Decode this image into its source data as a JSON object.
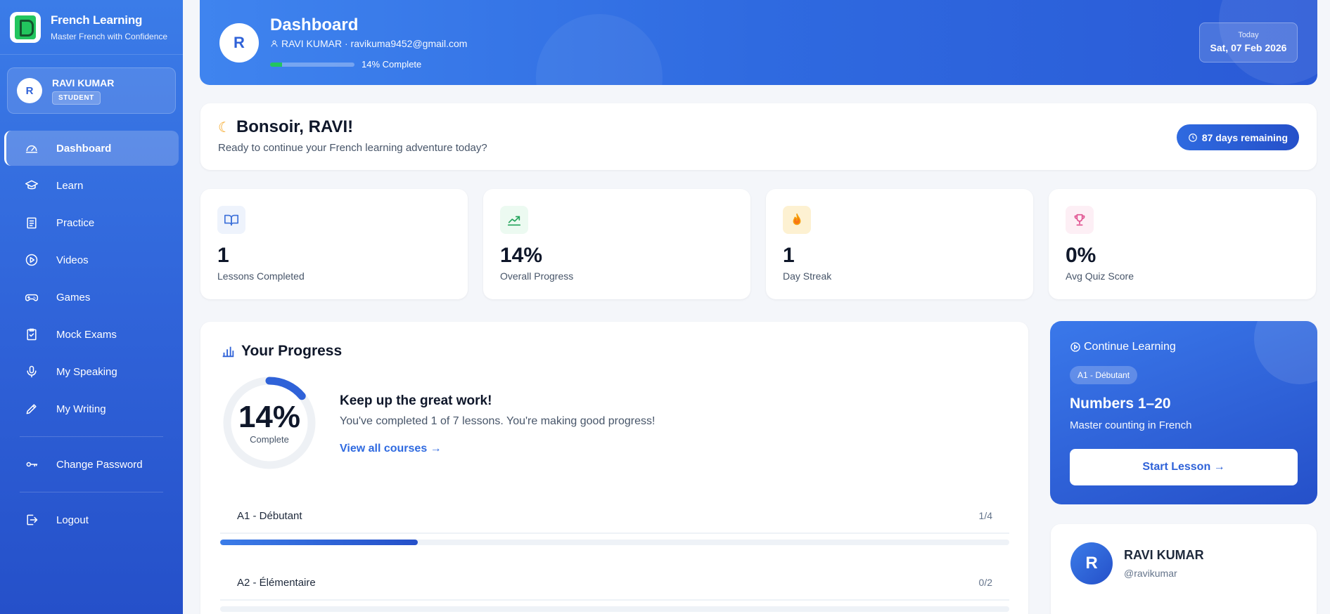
{
  "sidebar": {
    "brand_title": "French Learning",
    "brand_subtitle": "Master French with Confidence",
    "user": {
      "initial": "R",
      "name": "RAVI KUMAR",
      "role": "STUDENT"
    },
    "items": [
      {
        "label": "Dashboard",
        "icon": "dashboard-icon",
        "active": true
      },
      {
        "label": "Learn",
        "icon": "graduation-cap-icon"
      },
      {
        "label": "Practice",
        "icon": "clipboard-list-icon"
      },
      {
        "label": "Videos",
        "icon": "play-circle-icon"
      },
      {
        "label": "Games",
        "icon": "gamepad-icon"
      },
      {
        "label": "Mock Exams",
        "icon": "clipboard-check-icon"
      },
      {
        "label": "My Speaking",
        "icon": "microphone-icon"
      },
      {
        "label": "My Writing",
        "icon": "pen-icon"
      }
    ],
    "account": [
      {
        "label": "Change Password",
        "icon": "key-icon"
      },
      {
        "label": "Logout",
        "icon": "logout-icon"
      }
    ]
  },
  "header": {
    "initial": "R",
    "title": "Dashboard",
    "subtitle": "RAVI KUMAR · ravikuma9452@gmail.com",
    "progress_text": "14% Complete",
    "progress_value": 0.14,
    "date_label": "Today",
    "date_value": "Sat, 07 Feb 2026"
  },
  "greeting": {
    "title": "Bonsoir, RAVI!",
    "subtitle": "Ready to continue your French learning adventure today?",
    "days_remaining": "87 days remaining"
  },
  "stats": [
    {
      "value": "1",
      "label": "Lessons Completed",
      "icon": "book-open-icon",
      "color": "#3b6fd9",
      "bg": "#eef3fc"
    },
    {
      "value": "14%",
      "label": "Overall Progress",
      "icon": "trending-up-icon",
      "color": "#22a35a",
      "bg": "#ecfaf1"
    },
    {
      "value": "1",
      "label": "Day Streak",
      "icon": "flame-icon",
      "color": "#f59e0b",
      "bg": "#fdf1d2"
    },
    {
      "value": "0%",
      "label": "Avg Quiz Score",
      "icon": "trophy-icon",
      "color": "#e05290",
      "bg": "#fdeff5"
    }
  ],
  "progress": {
    "title": "Your Progress",
    "percent_text": "14%",
    "percent_value": 0.14,
    "ring_label": "Complete",
    "headline": "Keep up the great work!",
    "message": "You've completed 1 of 7 lessons. You're making good progress!",
    "link": "View all courses →",
    "levels": [
      {
        "name": "A1 - Débutant",
        "count": "1/4",
        "fill": 0.25
      },
      {
        "name": "A2 - Élémentaire",
        "count": "0/2",
        "fill": 0
      }
    ]
  },
  "continue": {
    "heading": "Continue Learning",
    "badge": "A1 - Débutant",
    "title": "Numbers 1–20",
    "subtitle": "Master counting in French",
    "button": "Start Lesson →"
  },
  "profile": {
    "initial": "R",
    "name": "RAVI KUMAR",
    "handle": "@ravikumar"
  }
}
